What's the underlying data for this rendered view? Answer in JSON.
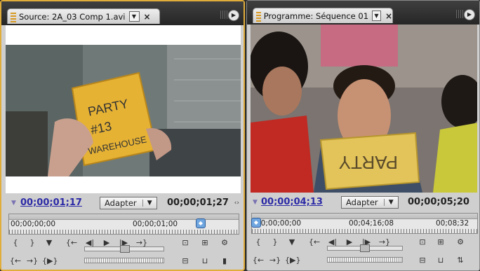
{
  "source": {
    "tab_title": "Source: 2A_03 Comp 1.avi",
    "current_time": "00;00;01;17",
    "fit_value": "Adapter",
    "duration": "00;00;01;27",
    "ruler_labels": [
      "00;00;00;00",
      "00;00;01;00"
    ],
    "frame_note": [
      "PARTY",
      "#13",
      "WAREHOUSE"
    ]
  },
  "program": {
    "tab_title": "Programme: Séquence 01",
    "current_time": "00;00;04;13",
    "fit_value": "Adapter",
    "duration": "00;00;05;20",
    "ruler_labels": [
      "00;00;00;00",
      "00;04;16;08",
      "00;08;32"
    ],
    "frame_sign": "PARTY"
  },
  "icons": {
    "dropdown": "▼",
    "close": "×",
    "panel_menu": "▶",
    "tiny": "‹›"
  },
  "colors": {
    "accent_border": "#e1ad3a",
    "timecode_link": "#2c2aa6"
  }
}
